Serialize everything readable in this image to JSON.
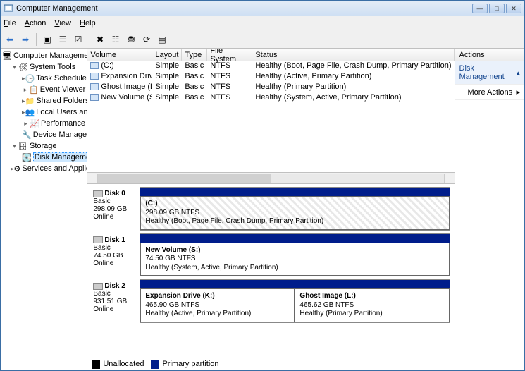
{
  "title": "Computer Management",
  "menu": {
    "file": "File",
    "action": "Action",
    "view": "View",
    "help": "Help"
  },
  "tree": {
    "root": "Computer Management (Local)",
    "systools": "System Tools",
    "task": "Task Scheduler",
    "event": "Event Viewer",
    "shared": "Shared Folders",
    "localusers": "Local Users and Groups",
    "perf": "Performance",
    "devmgr": "Device Manager",
    "storage": "Storage",
    "diskmgmt": "Disk Management",
    "services": "Services and Applications"
  },
  "cols": {
    "volume": "Volume",
    "layout": "Layout",
    "type": "Type",
    "fs": "File System",
    "status": "Status"
  },
  "vols": [
    {
      "name": "(C:)",
      "layout": "Simple",
      "type": "Basic",
      "fs": "NTFS",
      "status": "Healthy (Boot, Page File, Crash Dump, Primary Partition)"
    },
    {
      "name": "Expansion Drive (K:)",
      "layout": "Simple",
      "type": "Basic",
      "fs": "NTFS",
      "status": "Healthy (Active, Primary Partition)"
    },
    {
      "name": "Ghost Image (L:)",
      "layout": "Simple",
      "type": "Basic",
      "fs": "NTFS",
      "status": "Healthy (Primary Partition)"
    },
    {
      "name": "New Volume (S:)",
      "layout": "Simple",
      "type": "Basic",
      "fs": "NTFS",
      "status": "Healthy (System, Active, Primary Partition)"
    }
  ],
  "disks": [
    {
      "title": "Disk 0",
      "type": "Basic",
      "size": "298.09 GB",
      "state": "Online",
      "parts": [
        {
          "name": "(C:)",
          "size": "298.09 GB NTFS",
          "status": "Healthy (Boot, Page File, Crash Dump, Primary Partition)",
          "hatched": true
        }
      ]
    },
    {
      "title": "Disk 1",
      "type": "Basic",
      "size": "74.50 GB",
      "state": "Online",
      "parts": [
        {
          "name": "New Volume  (S:)",
          "size": "74.50 GB NTFS",
          "status": "Healthy (System, Active, Primary Partition)"
        }
      ]
    },
    {
      "title": "Disk 2",
      "type": "Basic",
      "size": "931.51 GB",
      "state": "Online",
      "parts": [
        {
          "name": "Expansion Drive  (K:)",
          "size": "465.90 GB NTFS",
          "status": "Healthy (Active, Primary Partition)"
        },
        {
          "name": "Ghost Image  (L:)",
          "size": "465.62 GB NTFS",
          "status": "Healthy (Primary Partition)"
        }
      ]
    }
  ],
  "legend": {
    "unalloc": "Unallocated",
    "primary": "Primary partition"
  },
  "actions": {
    "title": "Actions",
    "section": "Disk Management",
    "more": "More Actions"
  }
}
